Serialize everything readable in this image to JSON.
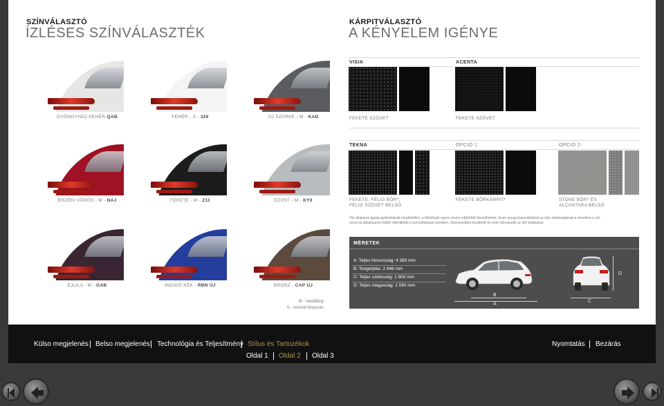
{
  "left": {
    "title": "SZÍNVÁLASZTÓ",
    "subtitle": "ÍZLÉSES SZÍNVÁLASZTÉK",
    "colors": [
      {
        "name": "GYÖNGYHÁZ-FEHÉR-",
        "code": "QAB",
        "color": "#e6e6e4"
      },
      {
        "name": "FEHÉR - S - ",
        "code": "326",
        "color": "#f4f4f4"
      },
      {
        "name": "ÚJ SZÜRKE - M - ",
        "code": "KAD",
        "color": "#5a5c60"
      },
      {
        "name": "ÉRZÉKI VÖRÖS - M - ",
        "code": "NAJ",
        "color": "#9e1224"
      },
      {
        "name": "FEKETE - M - ",
        "code": "Z11",
        "color": "#1c1c1d"
      },
      {
        "name": "EZÜST - M - ",
        "code": "KY0",
        "color": "#b9bcbf"
      },
      {
        "name": "ÉJLILA - M - ",
        "code": "GAB",
        "color": "#3a2632"
      },
      {
        "name": "INDIGÓ KÉK - ",
        "code": "RBN ÚJ",
        "color": "#233e9c"
      },
      {
        "name": "BRONZ - ",
        "code": "CAP ÚJ",
        "color": "#5b4a3d"
      }
    ],
    "legend_metallic": "M - metálfény",
    "legend_normal": "S - normál fényezés"
  },
  "right": {
    "title": "KÁRPITVÁLASZTÓ",
    "subtitle": "A KÉNYELEM IGÉNYE",
    "visia": {
      "header": "VISIA",
      "label": "FEKETE SZÖVET"
    },
    "acenta": {
      "header": "ACENTA",
      "label": "FEKETE SZÖVET"
    },
    "tekna": {
      "header": "TEKNA",
      "label_line1": "FEKETE, FÉLIG BŐR*,",
      "label_line2": "FÉLIG SZÖVET BELSŐ"
    },
    "opcio1": {
      "header": "OPCIÓ 1:",
      "label": "FEKETE BŐRKÁRPIT*"
    },
    "opcio2": {
      "header": "OPCIÓ 2:",
      "label_line1": "STONE BŐR* ÉS",
      "label_line2": "ALCANTARA BELSŐ"
    },
    "note_line1": "*Az általános igazgi gyakorlatnak megfelelően, a bőrülések egyes részei műbőrből készülhetnek. Ezen anyag használatával az ülés tartósságának a növelése a cél,",
    "note_line2": "mivel az alkalmazott műbőr ellenállóbb a karcolódással szemben, környezetben kezdhető és nem ráncosodik az idő múlásával."
  },
  "dimensions": {
    "title": "MÉRETEK",
    "items": [
      "A: Teljes hosszúság: 4 380 mm",
      "B: Tengelytáv: 2 646 mm",
      "C: Teljes szélesség: 1 800 mm",
      "D: Teljes magasság: 1 590 mm"
    ],
    "letter_a": "A",
    "letter_b": "B",
    "letter_c": "C",
    "letter_d": "D"
  },
  "footer": {
    "nav": [
      "Külso megjelenés",
      "Belso megjelenés",
      "Technológia és Teljesítmény",
      "Stílus és Tartozékok"
    ],
    "active_nav": "Stílus és Tartozékok",
    "print": "Nyomtatás",
    "close": "Bezárás",
    "pages": [
      "Oldal 1",
      "Oldal 2",
      "Oldal 3"
    ],
    "active_page": "Oldal 2",
    "accent_color": "#b58f50"
  },
  "icons": {
    "first": "skip-back-icon",
    "prev": "arrow-left-icon",
    "next": "arrow-right-icon",
    "last": "skip-forward-icon"
  }
}
